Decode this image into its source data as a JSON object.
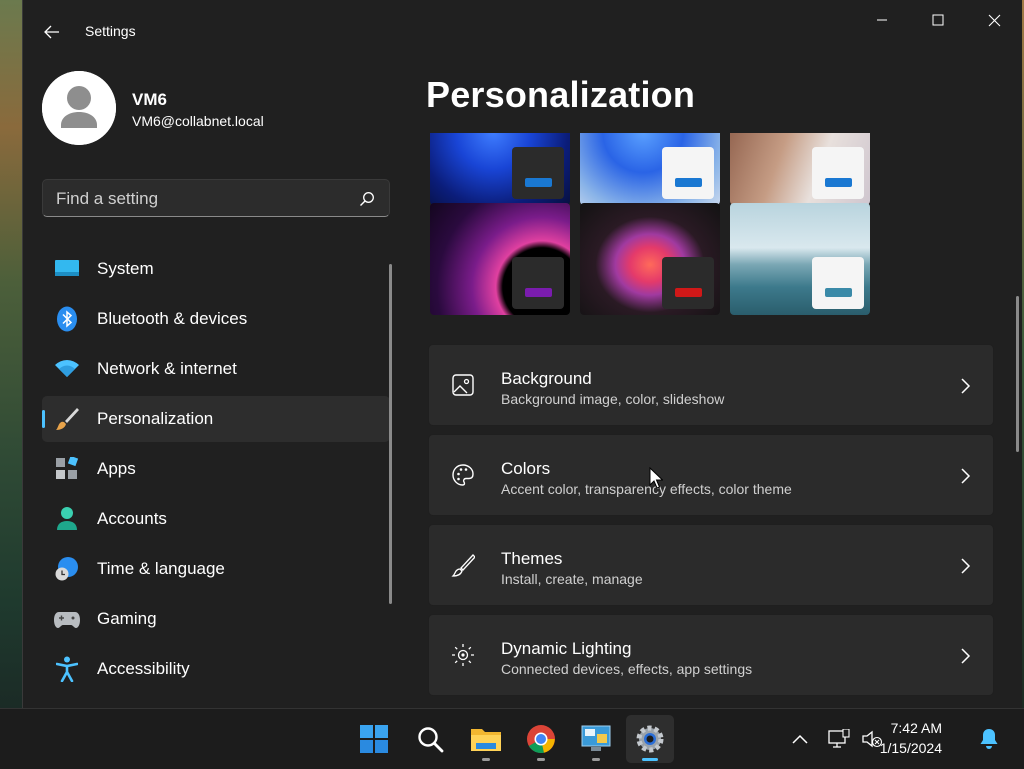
{
  "window": {
    "title": "Settings"
  },
  "profile": {
    "name": "VM6",
    "email": "VM6@collabnet.local"
  },
  "search": {
    "placeholder": "Find a setting"
  },
  "nav": {
    "items": [
      {
        "label": "System",
        "icon": "system-icon"
      },
      {
        "label": "Bluetooth & devices",
        "icon": "bluetooth-icon"
      },
      {
        "label": "Network & internet",
        "icon": "wifi-icon"
      },
      {
        "label": "Personalization",
        "icon": "paintbrush-icon",
        "active": true
      },
      {
        "label": "Apps",
        "icon": "apps-icon"
      },
      {
        "label": "Accounts",
        "icon": "accounts-icon"
      },
      {
        "label": "Time & language",
        "icon": "globe-clock-icon"
      },
      {
        "label": "Gaming",
        "icon": "gamepad-icon"
      },
      {
        "label": "Accessibility",
        "icon": "accessibility-icon"
      }
    ]
  },
  "page": {
    "title": "Personalization"
  },
  "cards": [
    {
      "title": "Background",
      "subtitle": "Background image, color, slideshow",
      "icon": "image-icon"
    },
    {
      "title": "Colors",
      "subtitle": "Accent color, transparency effects, color theme",
      "icon": "palette-icon"
    },
    {
      "title": "Themes",
      "subtitle": "Install, create, manage",
      "icon": "brush-icon"
    },
    {
      "title": "Dynamic Lighting",
      "subtitle": "Connected devices, effects, app settings",
      "icon": "lighting-icon"
    }
  ],
  "taskbar": {
    "time": "7:42 AM",
    "date": "1/15/2024",
    "apps": [
      "start-icon",
      "search-icon",
      "file-explorer-icon",
      "chrome-icon",
      "remote-desktop-icon",
      "settings-icon"
    ]
  },
  "colors": {
    "accent": "#4cc2ff",
    "background": "#202020",
    "card": "#2b2b2b"
  }
}
